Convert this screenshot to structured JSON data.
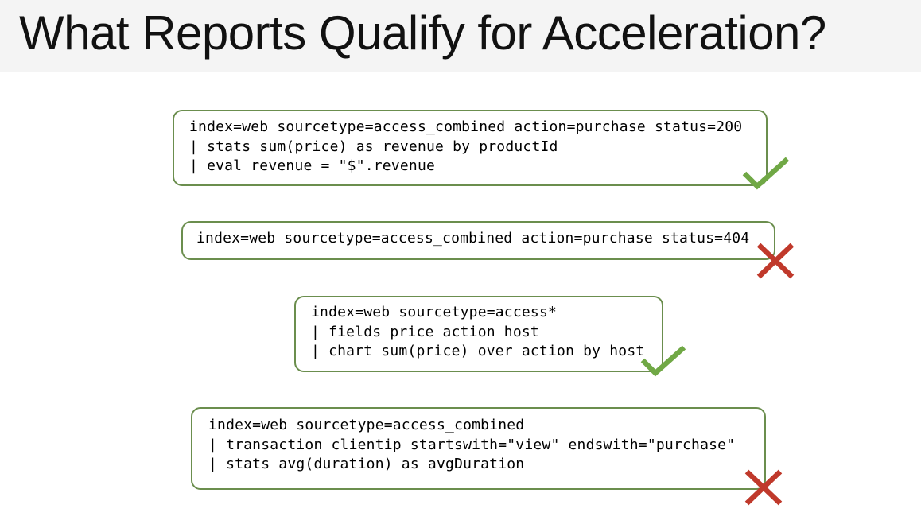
{
  "slide": {
    "title": "What Reports Qualify for Acceleration?"
  },
  "queries": [
    {
      "lines": [
        "index=web sourcetype=access_combined action=purchase status=200",
        "| stats sum(price) as revenue by productId",
        "| eval revenue = \"$\".revenue"
      ],
      "result": "check-icon"
    },
    {
      "lines": [
        "index=web sourcetype=access_combined action=purchase status=404"
      ],
      "result": "cross-icon"
    },
    {
      "lines": [
        "index=web sourcetype=access*",
        "| fields price action host",
        "| chart sum(price) over action by host"
      ],
      "result": "check-icon"
    },
    {
      "lines": [
        "index=web sourcetype=access_combined",
        "| transaction clientip startswith=\"view\" endswith=\"purchase\"",
        "| stats avg(duration) as avgDuration"
      ],
      "result": "cross-icon"
    }
  ],
  "colors": {
    "box_border": "#6b8e4e",
    "check": "#70a845",
    "cross": "#c0392b"
  }
}
